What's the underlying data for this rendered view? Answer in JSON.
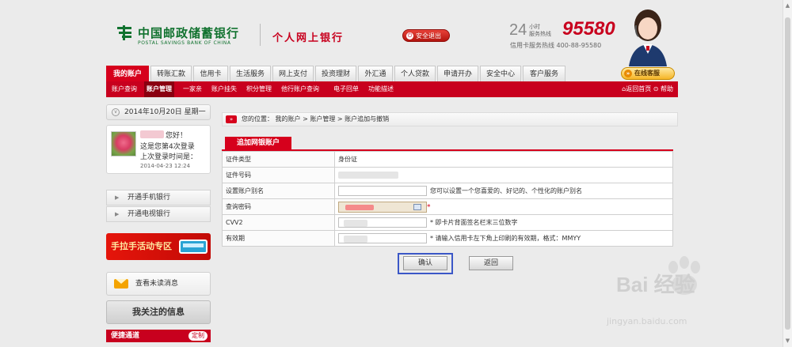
{
  "header": {
    "bank_cn": "中国邮政储蓄银行",
    "bank_en": "POSTAL SAVINGS BANK OF CHINA",
    "subtitle": "个人网上银行",
    "logout": "安全退出",
    "hotline_24": "24",
    "hotline_small": "小时\n服务热线",
    "hotline_number": "95580",
    "card_hotline": "信用卡服务热线  400-88-95580"
  },
  "nav": {
    "items": [
      "我的账户",
      "转账汇款",
      "信用卡",
      "生活服务",
      "网上支付",
      "投资理财",
      "外汇通",
      "个人贷款",
      "申请开办",
      "安全中心",
      "客户服务"
    ],
    "online_service": "在线客服"
  },
  "subnav": {
    "items": [
      "账户查询",
      "账户管理",
      "一家亲",
      "账户挂失",
      "积分管理",
      "他行账户查询",
      "电子回单",
      "功能描述"
    ],
    "right": "返回首页  ⊙ 帮助"
  },
  "sidebar": {
    "date": "2014年10月20日 星期一",
    "greeting": "您好！",
    "login_count": "这是您第4次登录",
    "last_login_label": "上次登录时间是：",
    "last_login_time": "2014-04-23 12:24",
    "links": [
      "开通手机银行",
      "开通电视银行"
    ],
    "promo": "手拉手活动专区",
    "unread": "查看未读消息",
    "follow": "我关注的信息",
    "quick": "便捷通道",
    "quick_custom": "定制"
  },
  "main": {
    "breadcrumb": "您的位置：  我的账户 > 账户管理 > 账户追加与撤销",
    "form_tab": "追加网银账户",
    "rows": [
      {
        "label": "证件类型",
        "value": "身份证"
      },
      {
        "label": "证件号码",
        "value": ""
      },
      {
        "label": "设置账户别名",
        "hint": "您可以设置一个您喜爱的、好记的、个性化的账户别名"
      },
      {
        "label": "查询密码",
        "hint": "*"
      },
      {
        "label": "CVV2",
        "hint": "* 即卡片背面签名栏末三位数字"
      },
      {
        "label": "有效期",
        "hint": "* 请输入信用卡左下角上印刷的有效期，格式：MMYY"
      }
    ],
    "confirm": "确认",
    "back": "返回"
  },
  "watermark": {
    "text": "Bai 经验",
    "sub": "jingyan.baidu.com"
  }
}
